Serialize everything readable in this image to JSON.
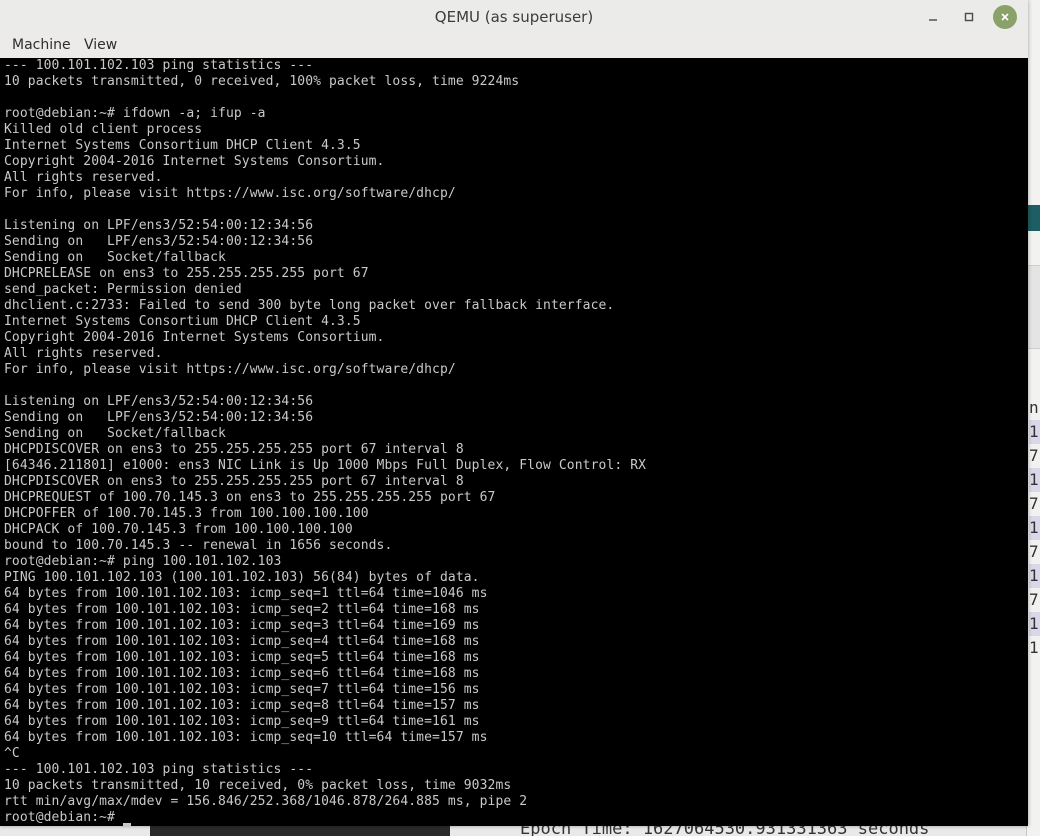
{
  "window": {
    "title": "QEMU (as superuser)"
  },
  "menubar": {
    "items": [
      "Machine",
      "View"
    ]
  },
  "terminal": {
    "lines": [
      "--- 100.101.102.103 ping statistics ---",
      "10 packets transmitted, 0 received, 100% packet loss, time 9224ms",
      "",
      "root@debian:~# ifdown -a; ifup -a",
      "Killed old client process",
      "Internet Systems Consortium DHCP Client 4.3.5",
      "Copyright 2004-2016 Internet Systems Consortium.",
      "All rights reserved.",
      "For info, please visit https://www.isc.org/software/dhcp/",
      "",
      "Listening on LPF/ens3/52:54:00:12:34:56",
      "Sending on   LPF/ens3/52:54:00:12:34:56",
      "Sending on   Socket/fallback",
      "DHCPRELEASE on ens3 to 255.255.255.255 port 67",
      "send_packet: Permission denied",
      "dhclient.c:2733: Failed to send 300 byte long packet over fallback interface.",
      "Internet Systems Consortium DHCP Client 4.3.5",
      "Copyright 2004-2016 Internet Systems Consortium.",
      "All rights reserved.",
      "For info, please visit https://www.isc.org/software/dhcp/",
      "",
      "Listening on LPF/ens3/52:54:00:12:34:56",
      "Sending on   LPF/ens3/52:54:00:12:34:56",
      "Sending on   Socket/fallback",
      "DHCPDISCOVER on ens3 to 255.255.255.255 port 67 interval 8",
      "[64346.211801] e1000: ens3 NIC Link is Up 1000 Mbps Full Duplex, Flow Control: RX",
      "DHCPDISCOVER on ens3 to 255.255.255.255 port 67 interval 8",
      "DHCPREQUEST of 100.70.145.3 on ens3 to 255.255.255.255 port 67",
      "DHCPOFFER of 100.70.145.3 from 100.100.100.100",
      "DHCPACK of 100.70.145.3 from 100.100.100.100",
      "bound to 100.70.145.3 -- renewal in 1656 seconds.",
      "root@debian:~# ping 100.101.102.103",
      "PING 100.101.102.103 (100.101.102.103) 56(84) bytes of data.",
      "64 bytes from 100.101.102.103: icmp_seq=1 ttl=64 time=1046 ms",
      "64 bytes from 100.101.102.103: icmp_seq=2 ttl=64 time=168 ms",
      "64 bytes from 100.101.102.103: icmp_seq=3 ttl=64 time=169 ms",
      "64 bytes from 100.101.102.103: icmp_seq=4 ttl=64 time=168 ms",
      "64 bytes from 100.101.102.103: icmp_seq=5 ttl=64 time=168 ms",
      "64 bytes from 100.101.102.103: icmp_seq=6 ttl=64 time=168 ms",
      "64 bytes from 100.101.102.103: icmp_seq=7 ttl=64 time=156 ms",
      "64 bytes from 100.101.102.103: icmp_seq=8 ttl=64 time=157 ms",
      "64 bytes from 100.101.102.103: icmp_seq=9 ttl=64 time=161 ms",
      "64 bytes from 100.101.102.103: icmp_seq=10 ttl=64 time=157 ms",
      "^C",
      "--- 100.101.102.103 ping statistics ---",
      "10 packets transmitted, 10 received, 0% packet loss, time 9032ms",
      "rtt min/avg/max/mdev = 156.846/252.368/1046.878/264.885 ms, pipe 2",
      "root@debian:~#"
    ]
  },
  "background_window": {
    "column_chars": [
      "n",
      "1",
      "7",
      "1",
      "7",
      "1",
      "7",
      "1",
      "7",
      "1",
      "1"
    ],
    "bottom_text": "Epoch Time: 1627064530.931331363 seconds"
  },
  "colors": {
    "terminal_bg": "#000000",
    "terminal_fg": "#c9c9c9",
    "close_button": "#8aa26a"
  },
  "icons": {
    "minimize": "minimize-icon",
    "maximize": "maximize-icon",
    "close": "close-icon"
  }
}
